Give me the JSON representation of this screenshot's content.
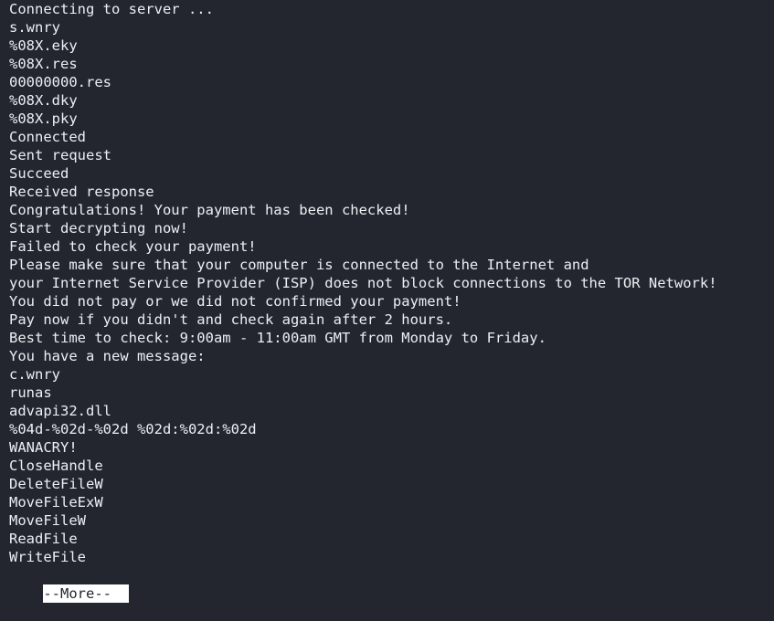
{
  "terminal": {
    "background_color": "#23262e",
    "text_color": "#eceff4",
    "prompt_highlight_background": "#ffffff",
    "prompt_highlight_text_color": "#23262e",
    "lines": [
      "Connecting to server ...",
      "s.wnry",
      "%08X.eky",
      "%08X.res",
      "00000000.res",
      "%08X.dky",
      "%08X.pky",
      "Connected",
      "Sent request",
      "Succeed",
      "Received response",
      "Congratulations! Your payment has been checked!",
      "Start decrypting now!",
      "Failed to check your payment!",
      "Please make sure that your computer is connected to the Internet and",
      "your Internet Service Provider (ISP) does not block connections to the TOR Network!",
      "You did not pay or we did not confirmed your payment!",
      "Pay now if you didn't and check again after 2 hours.",
      "Best time to check: 9:00am - 11:00am GMT from Monday to Friday.",
      "You have a new message:",
      "c.wnry",
      "runas",
      "advapi32.dll",
      "%04d-%02d-%02d %02d:%02d:%02d",
      "WANACRY!",
      "CloseHandle",
      "DeleteFileW",
      "MoveFileExW",
      "MoveFileW",
      "ReadFile",
      "WriteFile"
    ],
    "pager_prompt": {
      "label": "--More--",
      "cursor_padding": "  "
    }
  }
}
